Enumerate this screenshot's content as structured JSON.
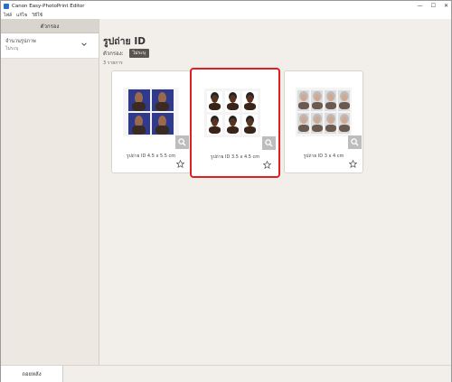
{
  "window": {
    "title": "Canon Easy-PhotoPrint Editor",
    "controls": [
      "—",
      "☐",
      "✕"
    ]
  },
  "menu": [
    "ไฟล์",
    "แก้ไข",
    "วิธีใช้"
  ],
  "sidebar": {
    "header": "ตัวกรอง",
    "filter": {
      "title": "จำนวนรูปภาพ",
      "value": "ไม่ระบุ"
    }
  },
  "main": {
    "title": "รูปถ่าย ID",
    "filter_label": "ตัวกรอง:",
    "filter_tag": "ไม่ระบุ",
    "count": "3 รายการ",
    "cards": [
      {
        "caption": "รูปถ่าย ID 4.5 x 5.5 cm"
      },
      {
        "caption": "รูปถ่าย ID 3.5 x 4.5 cm"
      },
      {
        "caption": "รูปถ่าย ID 3 x 4 cm"
      }
    ]
  },
  "footer": {
    "back_label": "ถอยหลัง"
  },
  "colors": {
    "selection": "#e02020",
    "sidebar_bg": "#ede9e2",
    "main_bg": "#f2efea"
  }
}
